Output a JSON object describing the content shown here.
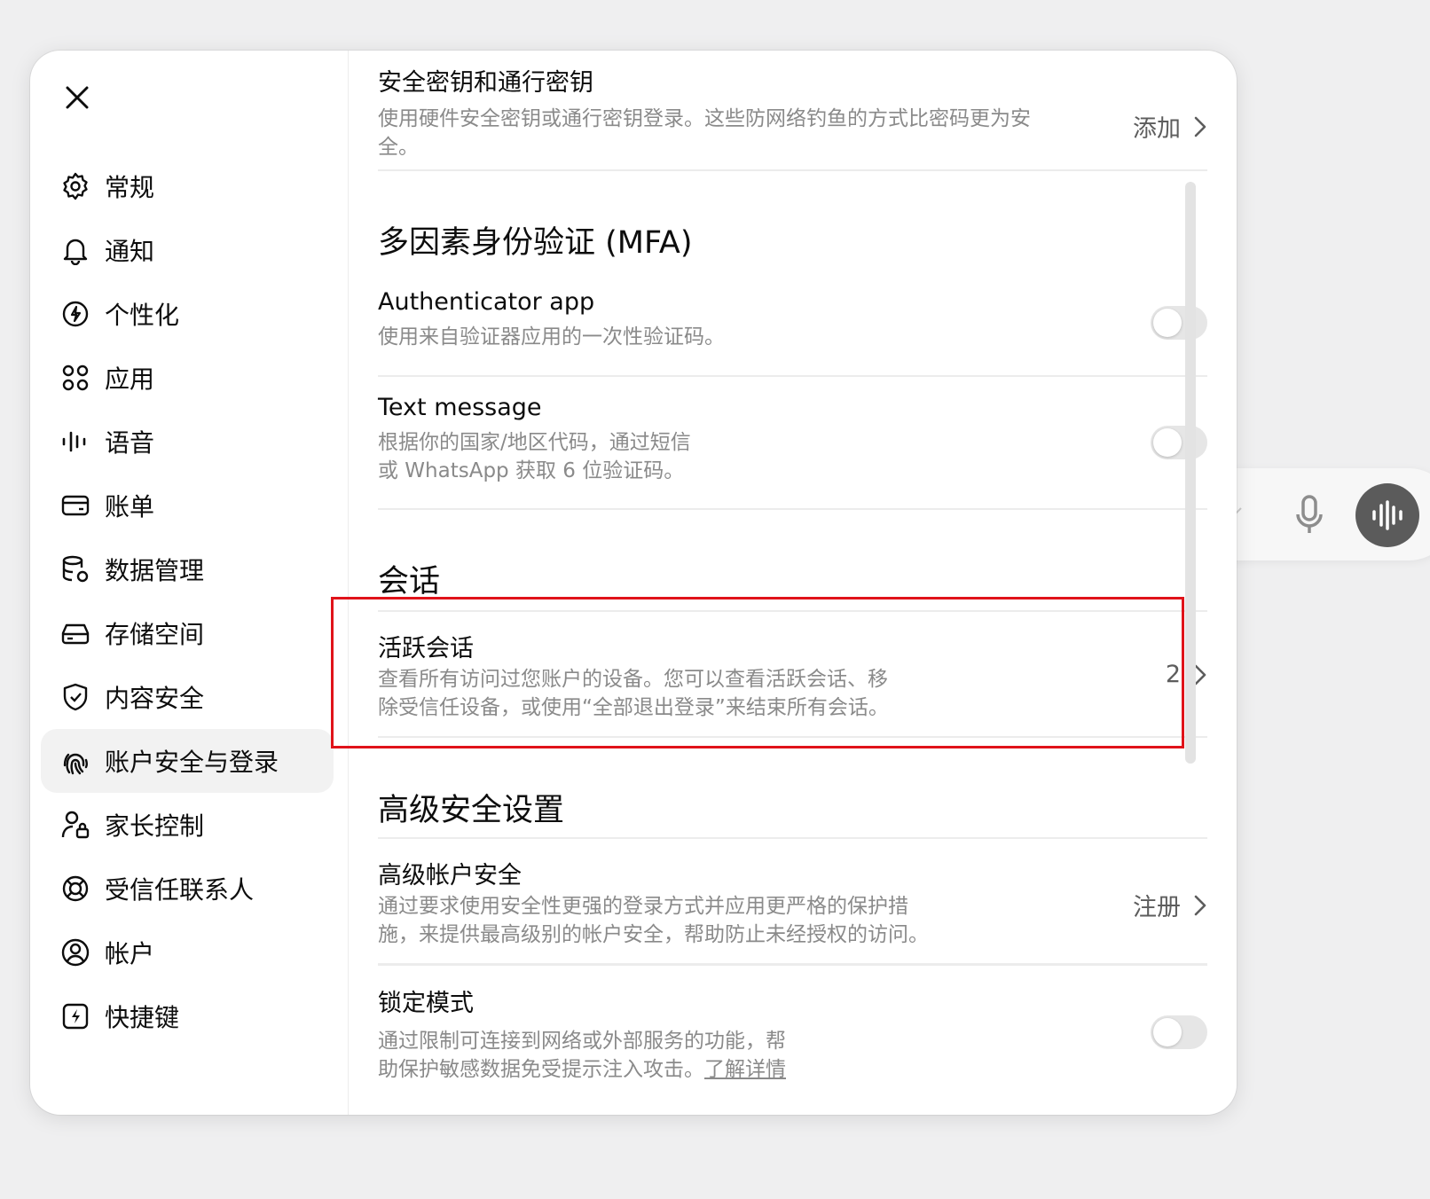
{
  "sidebar": {
    "items": [
      {
        "label": "常规",
        "icon": "gear-icon"
      },
      {
        "label": "通知",
        "icon": "bell-icon"
      },
      {
        "label": "个性化",
        "icon": "personalization-icon"
      },
      {
        "label": "应用",
        "icon": "apps-grid-icon"
      },
      {
        "label": "语音",
        "icon": "voice-waveform-icon"
      },
      {
        "label": "账单",
        "icon": "credit-card-icon"
      },
      {
        "label": "数据管理",
        "icon": "database-gear-icon"
      },
      {
        "label": "存储空间",
        "icon": "storage-drive-icon"
      },
      {
        "label": "内容安全",
        "icon": "shield-check-icon"
      },
      {
        "label": "账户安全与登录",
        "icon": "fingerprint-icon",
        "active": true
      },
      {
        "label": "家长控制",
        "icon": "parent-lock-icon"
      },
      {
        "label": "受信任联系人",
        "icon": "lifebuoy-icon"
      },
      {
        "label": "帐户",
        "icon": "user-circle-icon"
      },
      {
        "label": "快捷键",
        "icon": "lightning-key-icon"
      }
    ]
  },
  "security_keys": {
    "title": "安全密钥和通行密钥",
    "desc_line1": "使用硬件安全密钥或通行密钥登录。这些防网络钓鱼的方式比密码更为安",
    "desc_line2": "全。",
    "action": "添加"
  },
  "mfa": {
    "heading": "多因素身份验证 (MFA)",
    "authenticator": {
      "title": "Authenticator app",
      "desc": "使用来自验证器应用的一次性验证码。",
      "enabled": false
    },
    "text_message": {
      "title": "Text message",
      "desc_line1": "根据你的国家/地区代码，通过短信",
      "desc_line2": "或 WhatsApp 获取 6 位验证码。",
      "enabled": false
    }
  },
  "sessions": {
    "heading": "会话",
    "active": {
      "title": "活跃会话",
      "desc_line1": "查看所有访问过您账户的设备。您可以查看活跃会话、移",
      "desc_line2": "除受信任设备，或使用“全部退出登录”来结束所有会话。",
      "count": "2"
    }
  },
  "advanced": {
    "heading": "高级安全设置",
    "account_security": {
      "title": "高级帐户安全",
      "desc_line1": "通过要求使用安全性更强的登录方式并应用更严格的保护措",
      "desc_line2": "施，来提供最高级别的帐户安全，帮助防止未经授权的访问。",
      "action": "注册"
    },
    "lockdown": {
      "title": "锁定模式",
      "desc_line1": "通过限制可连接到网络或外部服务的功能，帮",
      "desc_line2": "助保护敏感数据免受提示注入攻击。",
      "link": "了解详情",
      "enabled": false
    }
  },
  "colors": {
    "highlight": "#e0131a",
    "background": "#efeff0",
    "active_item": "#f2f2f2"
  }
}
